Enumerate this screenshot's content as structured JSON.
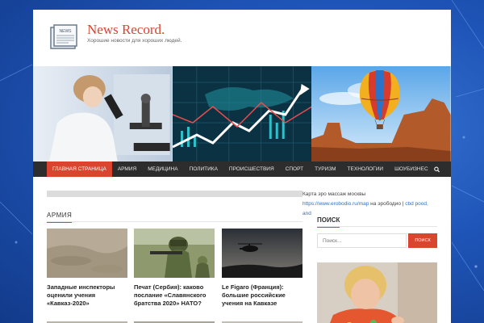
{
  "site": {
    "title": "News Record.",
    "tagline": "Хорошие новости для хороших людей.",
    "logo_label": "NEWS"
  },
  "nav": {
    "items": [
      {
        "label": "Главная страница",
        "active": true
      },
      {
        "label": "Армия"
      },
      {
        "label": "Медицина"
      },
      {
        "label": "Политика"
      },
      {
        "label": "Происшествия"
      },
      {
        "label": "Спорт"
      },
      {
        "label": "Туризм"
      },
      {
        "label": "Технологии"
      },
      {
        "label": "Шоубизнес"
      }
    ],
    "search_icon": "search-icon"
  },
  "ad": {
    "line1": "Карта эро массаж москвы",
    "link1": "https://www.erobodio.ru/map",
    "line2": " на эрободио | ",
    "link2": "cbd pood, and"
  },
  "section": {
    "title": "Армия"
  },
  "cards": [
    {
      "caption": "Западные инспекторы оценили учения «Кавказ-2020»"
    },
    {
      "caption": "Печат (Сербия): каково послание «Славянского братства 2020» НАТО?"
    },
    {
      "caption": "Le Figaro (Франция): большие российские учения на Кавказе"
    }
  ],
  "sidebar": {
    "search_title": "Поиск",
    "search_placeholder": "Поиск...",
    "search_button": "Поиск"
  },
  "colors": {
    "accent": "#d9452f",
    "nav_bg": "#2d2d2d",
    "link": "#2f6fc9"
  }
}
